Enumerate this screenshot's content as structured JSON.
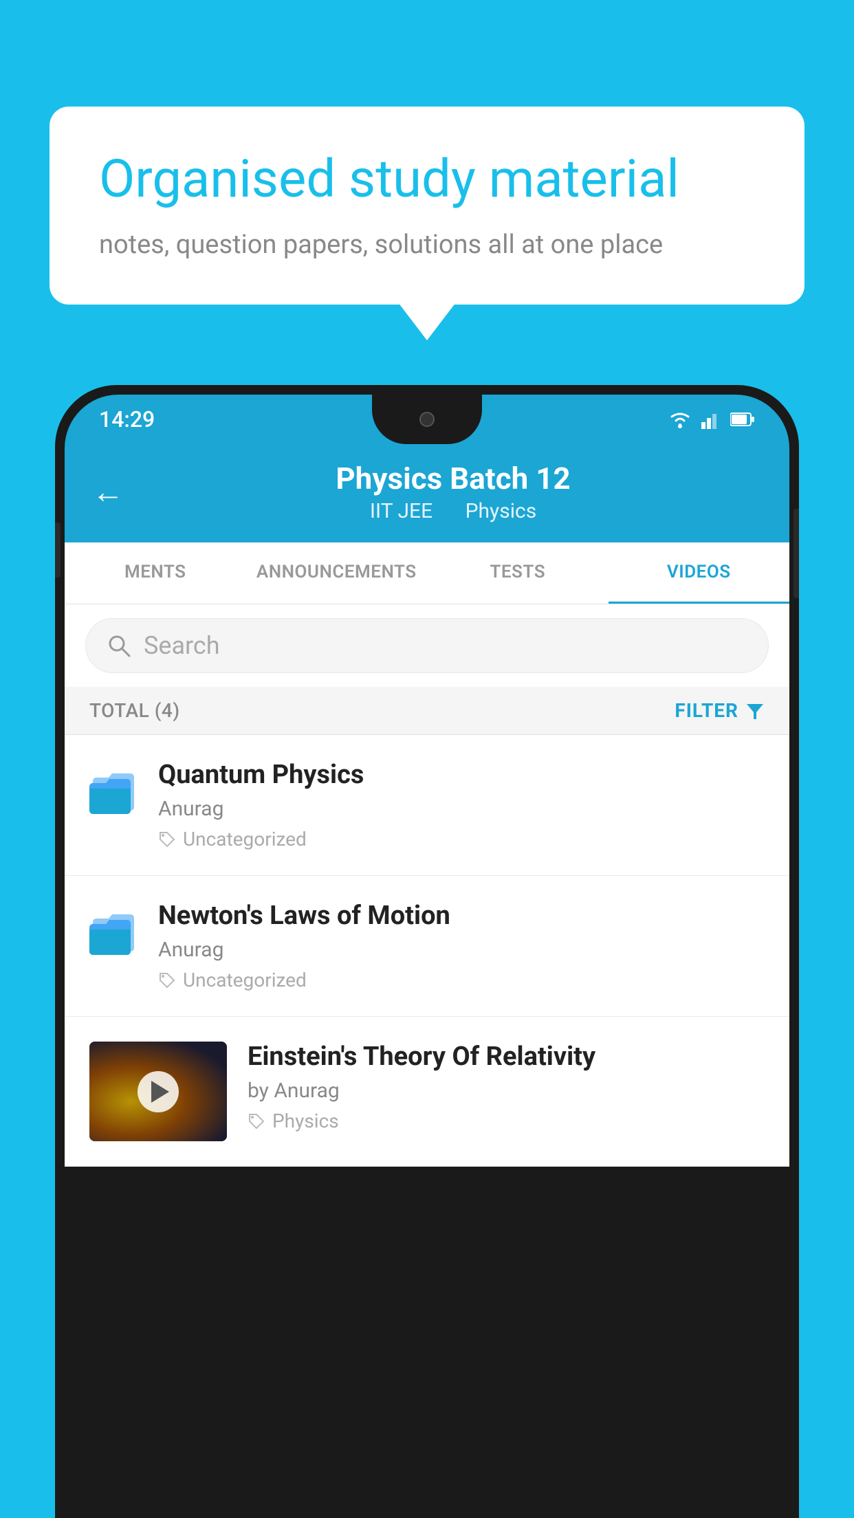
{
  "background_color": "#19BFEA",
  "bubble": {
    "title": "Organised study material",
    "subtitle": "notes, question papers, solutions all at one place"
  },
  "phone": {
    "status_bar": {
      "time": "14:29",
      "icons": [
        "wifi",
        "signal",
        "battery"
      ]
    },
    "header": {
      "title": "Physics Batch 12",
      "subtitle_left": "IIT JEE",
      "subtitle_right": "Physics",
      "back_label": "←"
    },
    "tabs": [
      {
        "label": "MENTS",
        "active": false
      },
      {
        "label": "ANNOUNCEMENTS",
        "active": false
      },
      {
        "label": "TESTS",
        "active": false
      },
      {
        "label": "VIDEOS",
        "active": true
      }
    ],
    "search": {
      "placeholder": "Search"
    },
    "filter_bar": {
      "total_label": "TOTAL (4)",
      "filter_label": "FILTER"
    },
    "videos": [
      {
        "title": "Quantum Physics",
        "author": "Anurag",
        "tag": "Uncategorized",
        "type": "folder"
      },
      {
        "title": "Newton's Laws of Motion",
        "author": "Anurag",
        "tag": "Uncategorized",
        "type": "folder"
      },
      {
        "title": "Einstein's Theory Of Relativity",
        "author": "by Anurag",
        "tag": "Physics",
        "type": "video"
      }
    ]
  }
}
